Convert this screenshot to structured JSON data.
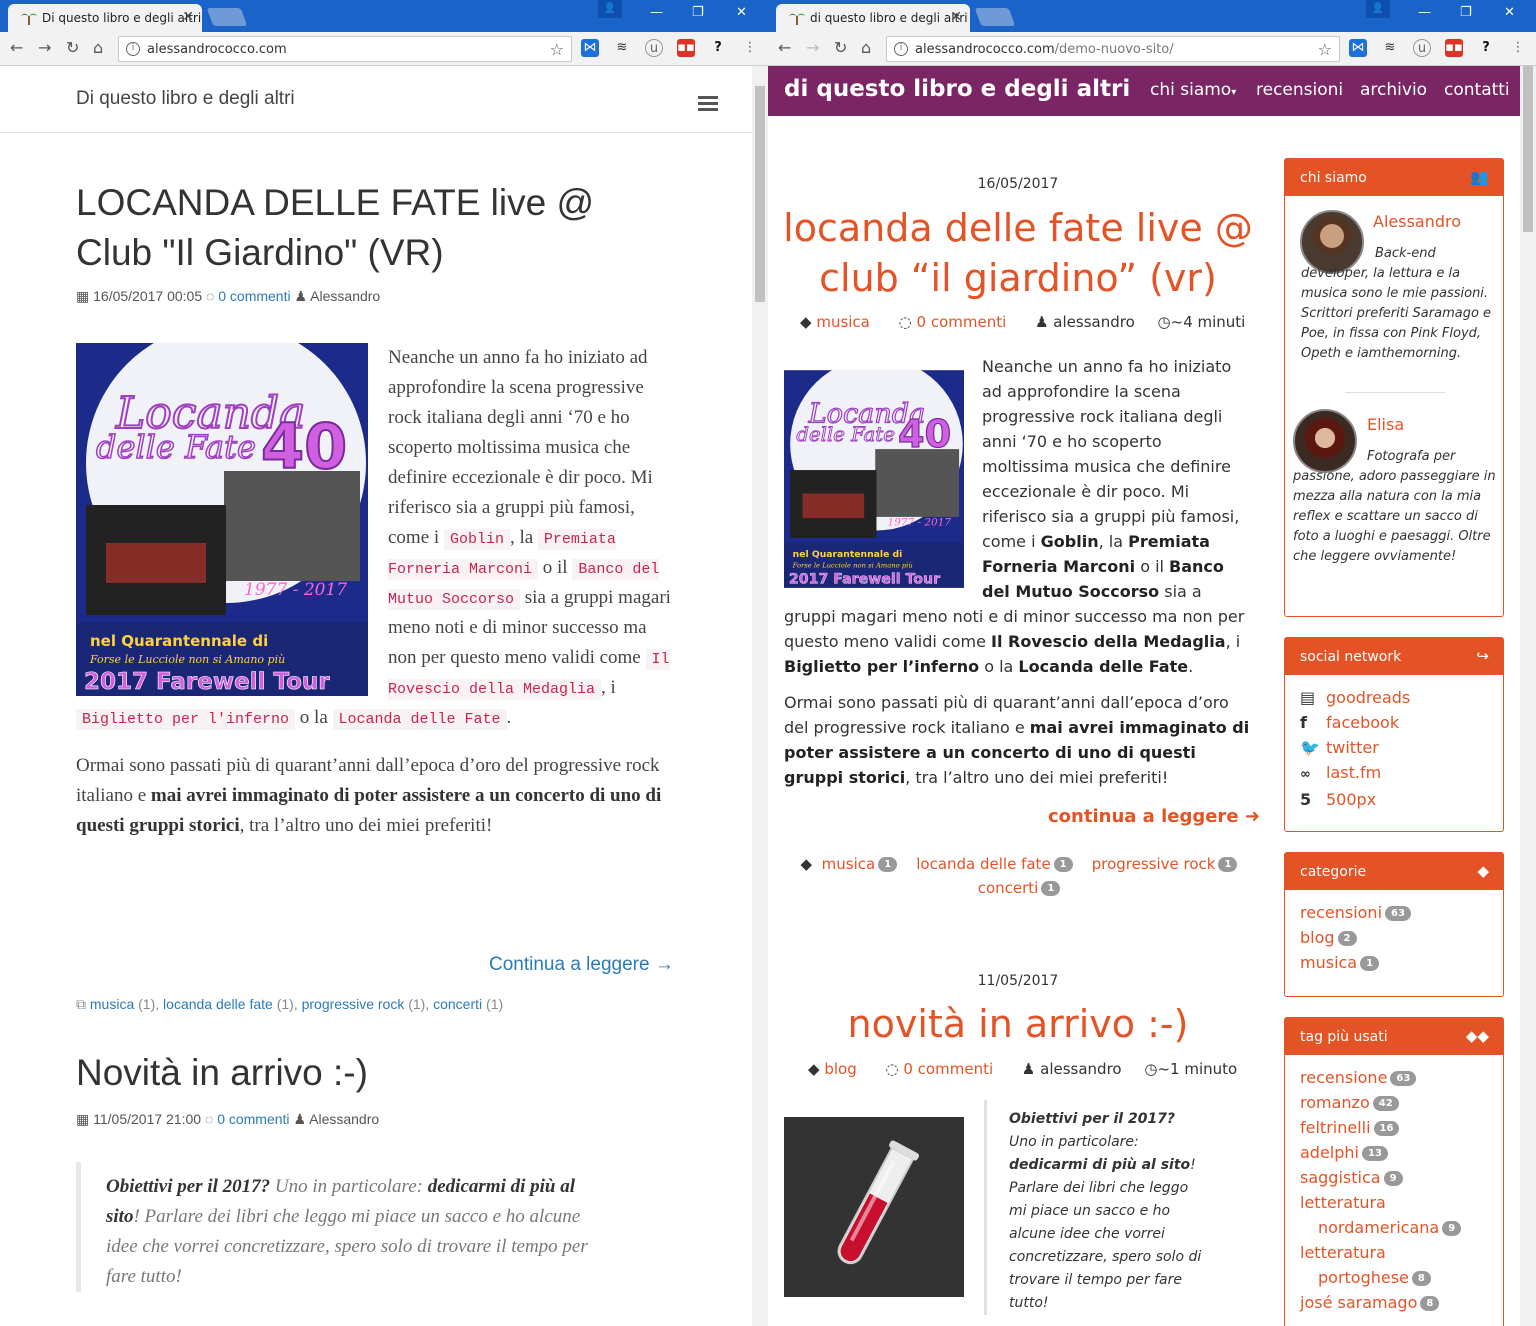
{
  "left": {
    "tab_title": "Di questo libro e degli altri",
    "url": "alessandrococco.com",
    "site": {
      "brand": "Di questo libro e degli altri",
      "post1": {
        "title": "LOCANDA DELLE FATE live @ Club \"Il Giardino\" (VR)",
        "date": "16/05/2017 00:05",
        "comments": "0 commenti",
        "author": "Alessandro",
        "p1_a": "Neanche un anno fa ho iniziato ad approfondire la scena progressive rock italiana degli anni ‘70 e ho scoperto moltissima musica che definire eccezionale è dir poco. Mi riferisco sia a gruppi più famosi, come i",
        "code_goblin": "Goblin",
        "t_la": ", la",
        "code_pfm": "Premiata Forneria Marconi",
        "t_oil": "o il",
        "code_banco": "Banco del Mutuo Soccorso",
        "p1_b": "sia a gruppi magari meno noti e di minor successo ma non per questo meno validi come",
        "code_rovescio": "Il Rovescio della Medaglia",
        "t_i": ", i",
        "code_biglietto": "Biglietto per l'inferno",
        "t_ola": "o la",
        "code_locanda": "Locanda delle Fate",
        "t_dot": ".",
        "p2_a": "Ormai sono passati più di quarant’anni dall’epoca d’oro del progressive rock italiano e",
        "p2_b": "mai avrei immaginato di poter assistere a un concerto di uno di questi gruppi storici",
        "p2_c": ", tra l’altro uno dei miei preferiti!",
        "more": "Continua a leggere →",
        "tags": [
          {
            "name": "musica",
            "count": "(1)"
          },
          {
            "name": "locanda delle fate",
            "count": "(1)"
          },
          {
            "name": "progressive rock",
            "count": "(1)"
          },
          {
            "name": "concerti",
            "count": "(1)"
          }
        ]
      },
      "post2": {
        "title": "Novità in arrivo :-)",
        "date": "11/05/2017 21:00",
        "comments": "0 commenti",
        "author": "Alessandro",
        "q_a": "Obiettivi per il 2017?",
        "q_b": " Uno in particolare: ",
        "q_c": "dedicarmi di più al sito",
        "q_d": "! Parlare dei libri che leggo mi piace un sacco e ho alcune idee che vorrei concretizzare, spero solo di trovare il tempo per fare tutto!"
      }
    }
  },
  "right": {
    "tab_title": "di questo libro e degli altri",
    "url_host": "alessandrococco.com",
    "url_path": "/demo-nuovo-sito/",
    "site": {
      "brand": "di questo libro e degli altri",
      "nav": [
        "chi siamo",
        "recensioni",
        "archivio",
        "contatti"
      ],
      "post1": {
        "date": "16/05/2017",
        "title": "locanda delle fate live @ club “il giardino” (vr)",
        "category": "musica",
        "comments": "0 commenti",
        "author": "alessandro",
        "read_time": "~4 minuti",
        "p1_a": "Neanche un anno fa ho iniziato ad approfondire la scena progressive rock italiana degli anni ‘70 e ho scoperto moltissima musica che definire eccezionale è dir poco. Mi riferisco sia a gruppi più famosi, come i ",
        "b_goblin": "Goblin",
        "t_la": ", la ",
        "b_pfm": "Premiata Forneria Marconi",
        "t_oil": " o il ",
        "b_banco": "Banco del Mutuo Soccorso",
        "p1_b": " sia a gruppi magari meno noti e di minor successo ma non per questo meno validi come ",
        "b_rovescio": "Il Rovescio della Medaglia",
        "t_i": ", i ",
        "b_biglietto": "Biglietto per l’inferno",
        "t_ola": " o la ",
        "b_locanda": "Locanda delle Fate",
        "t_dot": ".",
        "p2_a": "Ormai sono passati più di quarant’anni dall’epoca d’oro del progressive rock italiano e ",
        "p2_b": "mai avrei immaginato di poter assistere a un concerto di uno di questi gruppi storici",
        "p2_c": ", tra l’altro uno dei miei preferiti!",
        "more": "continua a leggere",
        "tags": [
          {
            "name": "musica",
            "count": "1"
          },
          {
            "name": "locanda delle fate",
            "count": "1"
          },
          {
            "name": "progressive rock",
            "count": "1"
          },
          {
            "name": "concerti",
            "count": "1"
          }
        ]
      },
      "post2": {
        "date": "11/05/2017",
        "title": "novità in arrivo :-)",
        "category": "blog",
        "comments": "0 commenti",
        "author": "alessandro",
        "read_time": "~1 minuto",
        "q_a": "Obiettivi per il 2017?",
        "q_b": " Uno in particolare: ",
        "q_c": "dedicarmi di più al sito",
        "q_d": "! Parlare dei libri che leggo mi piace un sacco e ho alcune idee che vorrei concretizzare, spero solo di trovare il tempo per fare tutto!"
      },
      "sidebar": {
        "chi_siamo": {
          "title": "chi siamo",
          "people": [
            {
              "name": "Alessandro",
              "bio": "Back-end developer, la lettura e la musica sono le mie passioni. Scrittori preferiti Saramago e Poe, in fissa con Pink Floyd, Opeth e iamthemorning."
            },
            {
              "name": "Elisa",
              "bio": "Fotografa per passione, adoro passeggiare in mezza alla natura con la mia reflex e scattare un sacco di foto a luoghi e paesaggi. Oltre che leggere ovviamente!"
            }
          ]
        },
        "social": {
          "title": "social network",
          "items": [
            "goodreads",
            "facebook",
            "twitter",
            "last.fm",
            "500px"
          ]
        },
        "categorie": {
          "title": "categorie",
          "items": [
            {
              "name": "recensioni",
              "count": "63"
            },
            {
              "name": "blog",
              "count": "2"
            },
            {
              "name": "musica",
              "count": "1"
            }
          ]
        },
        "tags": {
          "title": "tag più usati",
          "items": [
            {
              "name": "recensione",
              "count": "63"
            },
            {
              "name": "romanzo",
              "count": "42"
            },
            {
              "name": "feltrinelli",
              "count": "16"
            },
            {
              "name": "adelphi",
              "count": "13"
            },
            {
              "name": "saggistica",
              "count": "9"
            },
            {
              "name": "letteratura nordamericana",
              "count": "9"
            },
            {
              "name": "letteratura portoghese",
              "count": "8"
            },
            {
              "name": "josé saramago",
              "count": "8"
            }
          ]
        }
      }
    }
  },
  "poster": {
    "line1": "Locanda",
    "line2": "delle Fate",
    "number": "40",
    "years": "1977 - 2017",
    "sub1": "nel Quarantennale di",
    "sub2": "Forse le Lucciole non si Amano più",
    "tour": "2017 Farewell Tour"
  },
  "colors": {
    "accent_orange": "#e45326",
    "header_purple": "#7a2665",
    "link_blue": "#2a7ab8",
    "chrome_blue": "#1a63c9"
  }
}
